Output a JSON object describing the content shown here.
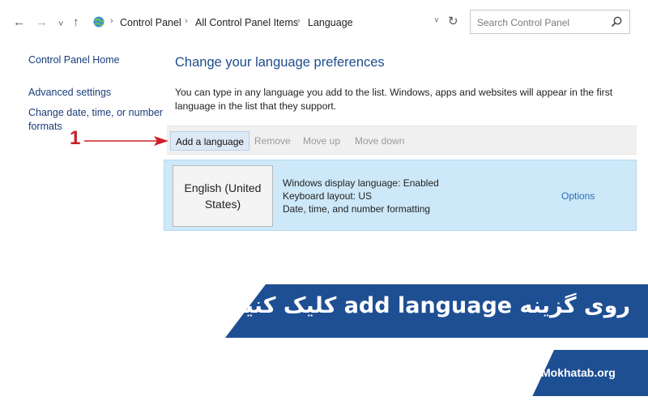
{
  "nav": {
    "back_glyph": "←",
    "forward_glyph": "→",
    "recent_glyph": "˅",
    "up_glyph": "↑",
    "icon": "control-panel-icon"
  },
  "breadcrumb": {
    "items": [
      "Control Panel",
      "All Control Panel Items",
      "Language"
    ],
    "separator": "›"
  },
  "address": {
    "dropdown_glyph": "˅",
    "refresh_glyph": "↻"
  },
  "search": {
    "placeholder": "Search Control Panel",
    "icon": "search-icon"
  },
  "left_pane": {
    "home": "Control Panel Home",
    "advanced": "Advanced settings",
    "date_time_line1": "Change date, time, or number",
    "date_time_line2": "formats"
  },
  "main": {
    "title": "Change your language preferences",
    "desc_line1": "You can type in any language you add to the list. Windows, apps and websites will appear in the first",
    "desc_line2": "language in the list that they support."
  },
  "toolbar": {
    "add": "Add a language",
    "remove": "Remove",
    "move_up": "Move up",
    "move_down": "Move down"
  },
  "language": {
    "tile_line1": "English (United",
    "tile_line2": "States)",
    "info1": "Windows display language: Enabled",
    "info2": "Keyboard layout: US",
    "info3": "Date, time, and number formatting",
    "options": "Options"
  },
  "annotation": {
    "step": "1",
    "arrow_color": "#d0202a"
  },
  "banner": {
    "text": "روی گزینه add language کلیک کنید",
    "color": "#1e4f93"
  },
  "brand": {
    "text": "Mokhatab.org",
    "color": "#1e4f93"
  },
  "colors": {
    "link": "#1a3d7a",
    "title": "#1e4d8c",
    "selection": "#cde8f8"
  }
}
